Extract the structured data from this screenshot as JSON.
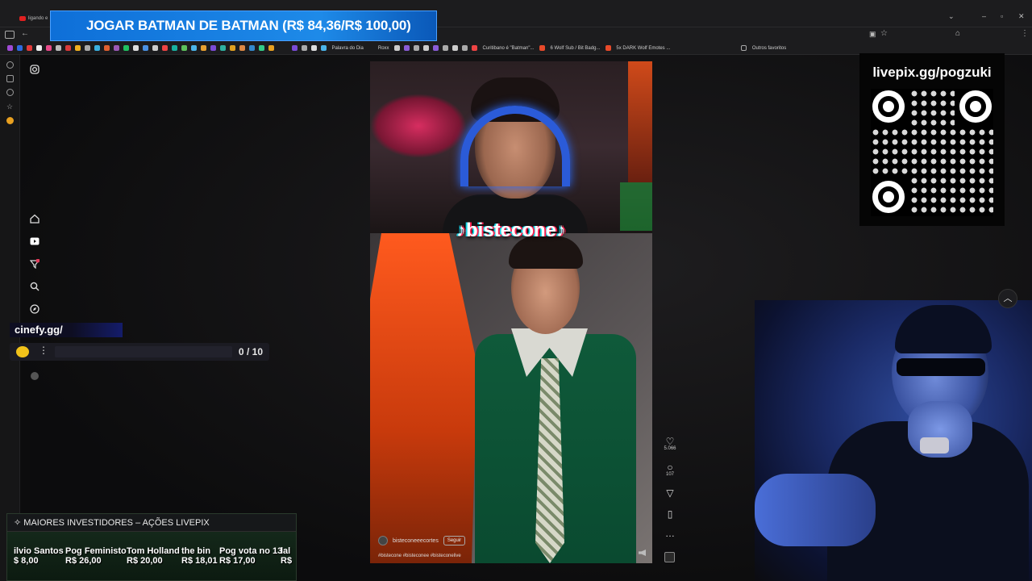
{
  "tab": {
    "label": "ligando e"
  },
  "banner": {
    "text": "JOGAR BATMAN DE BATMAN (R$ 84,36/R$ 100,00)"
  },
  "bookmarks": {
    "items": [
      "Palavra do Dia",
      "Roxx",
      "Curitibano é \"Batman\"...",
      "6 Wolf Sub / Bit Badg...",
      "5x DARK Wolf Emotes ...",
      "Outros favoritos"
    ]
  },
  "video": {
    "channel_overlay": "bistecone",
    "author": "bisteconeeecortes",
    "follow_label": "Seguir",
    "hashtags": "#bistecone #bisteconee #bisteconelive"
  },
  "actions": {
    "likes": "5.066",
    "comments": "107"
  },
  "qr": {
    "url": "livepix.gg/pogzuki"
  },
  "cinefy": {
    "label": "cinefy.gg/",
    "current": "0",
    "separator": "/",
    "total": "10"
  },
  "investors": {
    "title": "MAIORES INVESTIDORES – AÇÕES LIVEPIX",
    "items": [
      {
        "name": "ilvio Santos",
        "amount": "$ 8,00"
      },
      {
        "name": "Pog Feministo",
        "amount": "R$ 26,00"
      },
      {
        "name": "Tom Holland",
        "amount": "R$ 20,00"
      },
      {
        "name": "the bin",
        "amount": "R$ 18,01"
      },
      {
        "name": "Pog vota no 13",
        "amount": "R$ 17,00"
      },
      {
        "name": "lal",
        "amount": "R$"
      }
    ]
  },
  "colors": {
    "banner": "#1e8ae8",
    "vest": "#0f5a3a",
    "suit": "#ff5a1e"
  }
}
